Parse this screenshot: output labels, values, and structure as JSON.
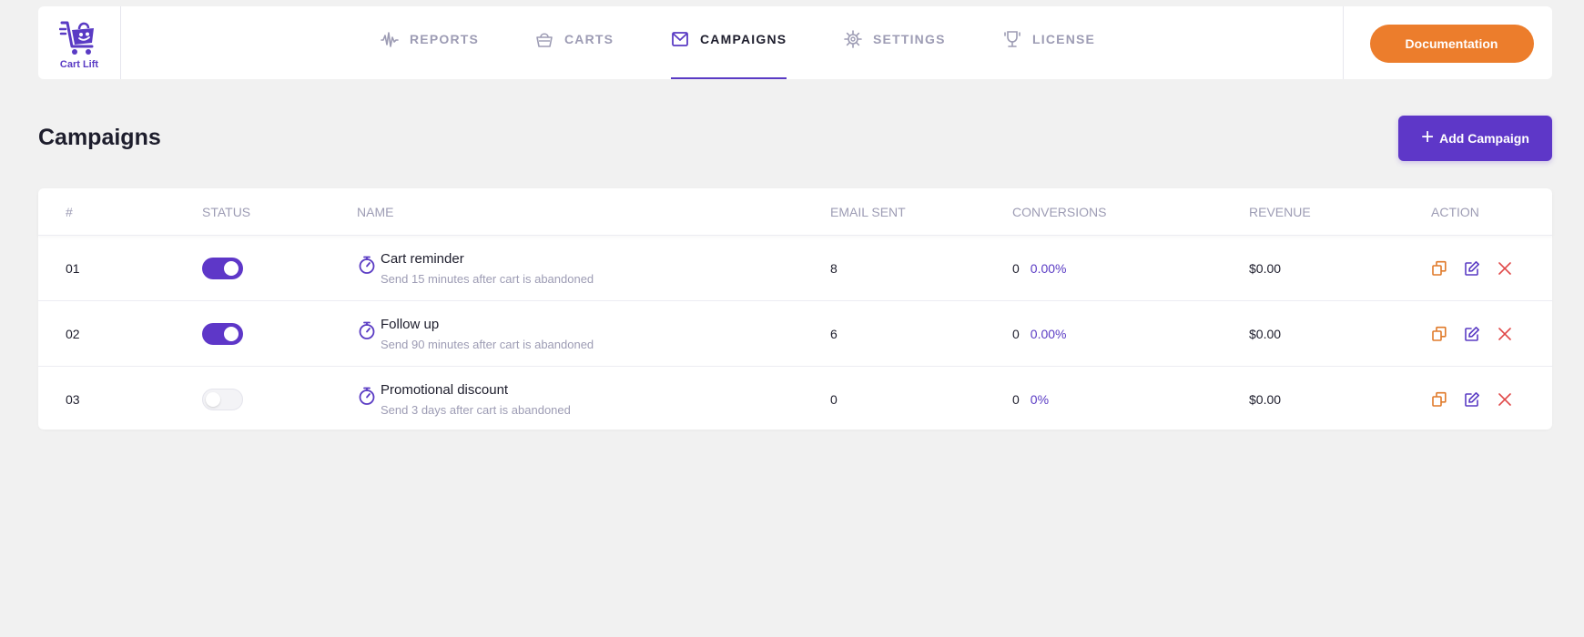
{
  "app": {
    "logo_text": "Cart Lift",
    "brand_color": "#5a3bc4",
    "accent_color": "#ec7d2c"
  },
  "nav": {
    "items": [
      {
        "label": "REPORTS",
        "icon": "waveform-icon",
        "active": false
      },
      {
        "label": "CARTS",
        "icon": "basket-icon",
        "active": false
      },
      {
        "label": "CAMPAIGNS",
        "icon": "envelope-icon",
        "active": true
      },
      {
        "label": "SETTINGS",
        "icon": "gear-icon",
        "active": false
      },
      {
        "label": "LICENSE",
        "icon": "trophy-icon",
        "active": false
      }
    ],
    "documentation_label": "Documentation"
  },
  "page": {
    "title": "Campaigns",
    "add_button_label": "Add Campaign",
    "add_button_icon": "plus-icon"
  },
  "table": {
    "headers": [
      "#",
      "STATUS",
      "NAME",
      "EMAIL SENT",
      "CONVERSIONS",
      "REVENUE",
      "ACTION"
    ],
    "rows": [
      {
        "num": "01",
        "enabled": true,
        "name": "Cart reminder",
        "description": "Send 15 minutes after cart is abandoned",
        "email_sent": "8",
        "conversions": "0",
        "conversion_rate": "0.00%",
        "revenue": "$0.00"
      },
      {
        "num": "02",
        "enabled": true,
        "name": "Follow up",
        "description": "Send 90 minutes after cart is abandoned",
        "email_sent": "6",
        "conversions": "0",
        "conversion_rate": "0.00%",
        "revenue": "$0.00"
      },
      {
        "num": "03",
        "enabled": false,
        "name": "Promotional discount",
        "description": "Send 3 days after cart is abandoned",
        "email_sent": "0",
        "conversions": "0",
        "conversion_rate": "0%",
        "revenue": "$0.00"
      }
    ],
    "actions": [
      {
        "icon": "duplicate-icon",
        "color": "#e07a2a"
      },
      {
        "icon": "edit-icon",
        "color": "#5a3bc4"
      },
      {
        "icon": "delete-icon",
        "color": "#e04848"
      }
    ]
  }
}
